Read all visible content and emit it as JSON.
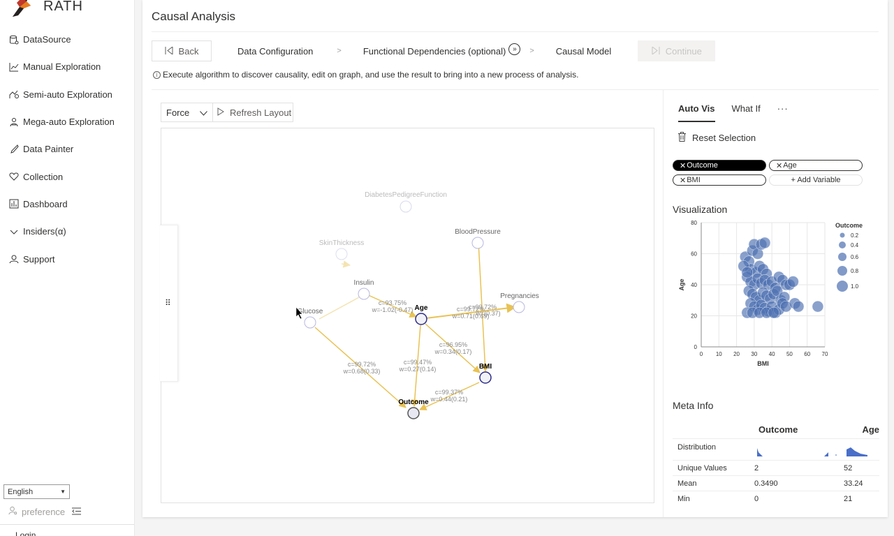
{
  "app": {
    "name": "RATH"
  },
  "sidebar": {
    "items": [
      {
        "label": "DataSource",
        "icon": "database-icon"
      },
      {
        "label": "Manual Exploration",
        "icon": "line-chart-icon"
      },
      {
        "label": "Semi-auto Exploration",
        "icon": "semi-auto-icon"
      },
      {
        "label": "Mega-auto Exploration",
        "icon": "robot-icon"
      },
      {
        "label": "Data Painter",
        "icon": "brush-icon"
      },
      {
        "label": "Collection",
        "icon": "heart-icon"
      },
      {
        "label": "Dashboard",
        "icon": "dashboard-icon"
      },
      {
        "label": "Insiders(α)",
        "icon": "chevron-down-icon"
      },
      {
        "label": "Support",
        "icon": "user-icon"
      }
    ],
    "language": "English",
    "preference": "preference",
    "login": "Login"
  },
  "page": {
    "title": "Causal Analysis",
    "back": "Back",
    "steps": [
      "Data Configuration",
      "Functional Dependencies (optional)",
      "Causal Model"
    ],
    "step_sep": ">",
    "continue": "Continue",
    "info": "Execute algorithm to discover causality, edit on graph, and use the result to bring into a new process of analysis."
  },
  "graph": {
    "layout": "Force",
    "refresh": "Refresh Layout",
    "nodes": [
      {
        "name": "DiabetesPedigreeFunction",
        "faded": true
      },
      {
        "name": "BloodPressure",
        "faded": false
      },
      {
        "name": "SkinThickness",
        "faded": true
      },
      {
        "name": "Insulin",
        "faded": false
      },
      {
        "name": "Pregnancies",
        "faded": false
      },
      {
        "name": "Glucose",
        "faded": false
      },
      {
        "name": "Age",
        "selected": true
      },
      {
        "name": "BMI",
        "selected": true
      },
      {
        "name": "Outcome",
        "selected": true
      }
    ],
    "edge_labels": [
      {
        "c": "c=93.75%",
        "w": "w=-1.02(-0.47)"
      },
      {
        "c": "c=99.72%",
        "w": "w=0.71(0.69)",
        "c2": "c=99.72%",
        "w2": "w=(0.37)"
      },
      {
        "c": "c=96.95%",
        "w": "w=0.34(0.17)"
      },
      {
        "c": "c=99.47%",
        "w": "w=0.27(0.14)"
      },
      {
        "c": "c=99.72%",
        "w": "w=0.68(0.33)"
      },
      {
        "c": "c=99.37%",
        "w": "w=0.44(0.21)"
      }
    ]
  },
  "right": {
    "tabs": [
      "Auto Vis",
      "What If"
    ],
    "more": "···",
    "reset": "Reset Selection",
    "chips": [
      "Outcome",
      "Age",
      "BMI"
    ],
    "add_variable": "+ Add Variable",
    "visualization_title": "Visualization",
    "meta_title": "Meta Info",
    "meta": {
      "columns": [
        "Outcome",
        "Age"
      ],
      "rows": [
        {
          "label": "Distribution",
          "values": [
            "",
            ""
          ]
        },
        {
          "label": "Unique Values",
          "values": [
            "2",
            "52"
          ]
        },
        {
          "label": "Mean",
          "values": [
            "0.3490",
            "33.24"
          ]
        },
        {
          "label": "Min",
          "values": [
            "0",
            "21"
          ]
        }
      ]
    }
  },
  "chart_data": {
    "type": "scatter",
    "xlabel": "BMI",
    "ylabel": "Age",
    "xlim": [
      0,
      70
    ],
    "ylim": [
      0,
      80
    ],
    "x_ticks": [
      0,
      10,
      20,
      30,
      40,
      50,
      60,
      70
    ],
    "y_ticks": [
      0,
      20,
      40,
      60,
      80
    ],
    "legend_title": "Outcome",
    "legend_values": [
      "0.2",
      "0.4",
      "0.6",
      "0.8",
      "1.0"
    ],
    "legend_position": "right",
    "color": "#4c6fb0",
    "points": [
      [
        25,
        58
      ],
      [
        27,
        55
      ],
      [
        29,
        62
      ],
      [
        30,
        66
      ],
      [
        32,
        60
      ],
      [
        34,
        66
      ],
      [
        36,
        67
      ],
      [
        28,
        50
      ],
      [
        31,
        48
      ],
      [
        33,
        52
      ],
      [
        35,
        50
      ],
      [
        37,
        47
      ],
      [
        26,
        45
      ],
      [
        28,
        42
      ],
      [
        30,
        40
      ],
      [
        32,
        44
      ],
      [
        34,
        41
      ],
      [
        36,
        43
      ],
      [
        38,
        40
      ],
      [
        40,
        42
      ],
      [
        42,
        38
      ],
      [
        44,
        45
      ],
      [
        46,
        43
      ],
      [
        48,
        40
      ],
      [
        27,
        36
      ],
      [
        29,
        34
      ],
      [
        31,
        32
      ],
      [
        33,
        30
      ],
      [
        35,
        35
      ],
      [
        37,
        33
      ],
      [
        39,
        31
      ],
      [
        41,
        34
      ],
      [
        43,
        36
      ],
      [
        45,
        30
      ],
      [
        47,
        32
      ],
      [
        28,
        28
      ],
      [
        30,
        26
      ],
      [
        32,
        24
      ],
      [
        34,
        27
      ],
      [
        36,
        25
      ],
      [
        38,
        23
      ],
      [
        40,
        26
      ],
      [
        42,
        22
      ],
      [
        44,
        24
      ],
      [
        46,
        28
      ],
      [
        48,
        26
      ],
      [
        26,
        22
      ],
      [
        29,
        22
      ],
      [
        33,
        22
      ],
      [
        37,
        22
      ],
      [
        41,
        22
      ],
      [
        53,
        28
      ],
      [
        55,
        26
      ],
      [
        50,
        40
      ],
      [
        52,
        42
      ],
      [
        66,
        26
      ],
      [
        24,
        52
      ],
      [
        26,
        48
      ]
    ]
  }
}
